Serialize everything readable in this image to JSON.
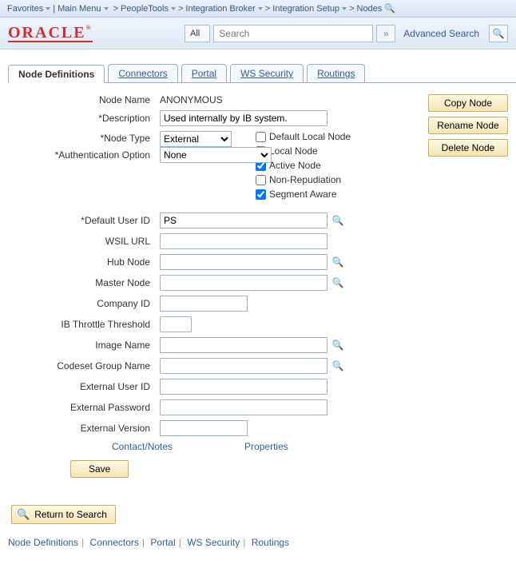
{
  "topnav": {
    "favorites": "Favorites",
    "mainmenu": "Main Menu",
    "crumbs": [
      "PeopleTools",
      "Integration Broker",
      "Integration Setup",
      "Nodes"
    ]
  },
  "header": {
    "logo": "ORACLE",
    "scope": "All",
    "search_placeholder": "Search",
    "advanced": "Advanced Search"
  },
  "tabs": [
    "Node Definitions",
    "Connectors",
    "Portal",
    "WS Security",
    "Routings"
  ],
  "active_tab": 0,
  "buttons": {
    "copy": "Copy Node",
    "rename": "Rename Node",
    "delete": "Delete Node"
  },
  "form": {
    "labels": {
      "node_name": "Node Name",
      "description": "*Description",
      "node_type": "*Node Type",
      "auth_option": "*Authentication Option",
      "default_user": "*Default User ID",
      "wsil": "WSIL URL",
      "hub": "Hub Node",
      "master": "Master Node",
      "company": "Company ID",
      "ib_throttle": "IB Throttle Threshold",
      "image_name": "Image Name",
      "codeset": "Codeset Group Name",
      "ext_user": "External User ID",
      "ext_pass": "External Password",
      "ext_ver": "External Version"
    },
    "values": {
      "node_name": "ANONYMOUS",
      "description": "Used internally by IB system.",
      "node_type": "External",
      "auth_option": "None",
      "default_user": "PS",
      "wsil": "",
      "hub": "",
      "master": "",
      "company": "",
      "ib_throttle": "",
      "image_name": "",
      "codeset": "",
      "ext_user": "",
      "ext_pass": "",
      "ext_ver": ""
    },
    "checks": {
      "default_local": {
        "label": "Default Local Node",
        "checked": false
      },
      "local_node": {
        "label": "Local Node",
        "checked": false
      },
      "active_node": {
        "label": "Active Node",
        "checked": true
      },
      "non_repud": {
        "label": "Non-Repudiation",
        "checked": false
      },
      "segment_aware": {
        "label": "Segment Aware",
        "checked": true
      }
    }
  },
  "links": {
    "contact": "Contact/Notes",
    "properties": "Properties"
  },
  "actions": {
    "save": "Save",
    "return": "Return to Search"
  },
  "footer": [
    "Node Definitions",
    "Connectors",
    "Portal",
    "WS Security",
    "Routings"
  ]
}
